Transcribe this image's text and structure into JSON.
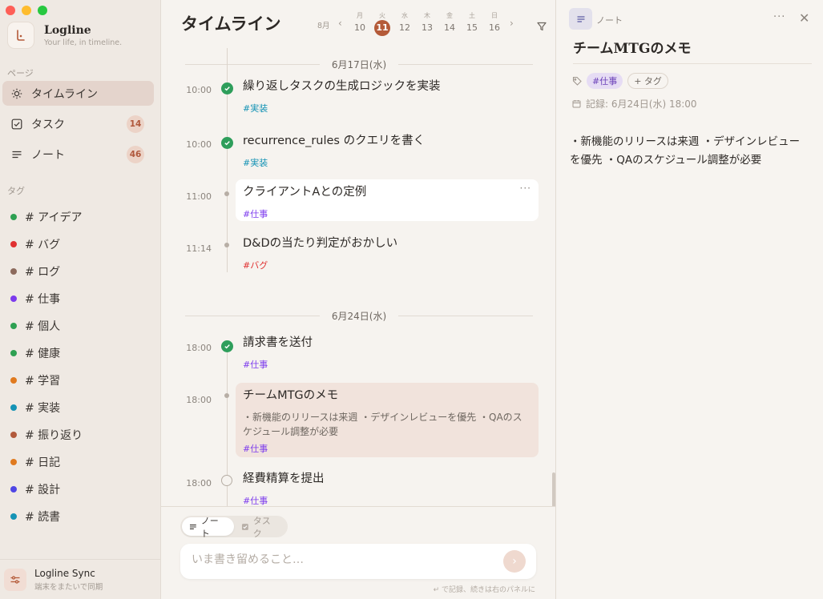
{
  "app": {
    "name": "Logline",
    "tagline": "Your life, in timeline."
  },
  "sidebar": {
    "pages_label": "ページ",
    "nav": [
      {
        "label": "タイムライン",
        "icon": "sun-icon",
        "badge": ""
      },
      {
        "label": "タスク",
        "icon": "checkbox-icon",
        "badge": "14"
      },
      {
        "label": "ノート",
        "icon": "lines-icon",
        "badge": "46"
      }
    ],
    "tags_label": "タグ",
    "tags": [
      {
        "label": "# アイデア",
        "color": "#2ea052"
      },
      {
        "label": "# バグ",
        "color": "#e03131"
      },
      {
        "label": "# ログ",
        "color": "#8c6a5c"
      },
      {
        "label": "# 仕事",
        "color": "#7c3aed"
      },
      {
        "label": "# 個人",
        "color": "#2ea052"
      },
      {
        "label": "# 健康",
        "color": "#2ea052"
      },
      {
        "label": "# 学習",
        "color": "#e07a1f"
      },
      {
        "label": "# 実装",
        "color": "#1593b5"
      },
      {
        "label": "# 振り返り",
        "color": "#b25a3c"
      },
      {
        "label": "# 日記",
        "color": "#e07a1f"
      },
      {
        "label": "# 設計",
        "color": "#4f46e5"
      },
      {
        "label": "# 読書",
        "color": "#1593b5"
      }
    ],
    "sync": {
      "title": "Logline Sync",
      "subtitle": "端末をまたいで同期"
    }
  },
  "timeline": {
    "title": "タイムライン",
    "month": "8月",
    "days": [
      {
        "weekday": "月",
        "num": "10",
        "active": false
      },
      {
        "weekday": "火",
        "num": "11",
        "active": true
      },
      {
        "weekday": "水",
        "num": "12",
        "active": false
      },
      {
        "weekday": "木",
        "num": "13",
        "active": false
      },
      {
        "weekday": "金",
        "num": "14",
        "active": false
      },
      {
        "weekday": "土",
        "num": "15",
        "active": false
      },
      {
        "weekday": "日",
        "num": "16",
        "active": false
      }
    ],
    "groups": [
      {
        "date": "6月17日(水)",
        "entries": [
          {
            "time": "10:00",
            "title": "繰り返しタスクの生成ロジックを実装",
            "tag": "#実装",
            "tag_color": "#1593b5",
            "status": "done"
          },
          {
            "time": "10:00",
            "title": "recurrence_rules のクエリを書く",
            "tag": "#実装",
            "tag_color": "#1593b5",
            "status": "done"
          },
          {
            "time": "11:00",
            "title": "クライアントAとの定例",
            "tag": "#仕事",
            "tag_color": "#7c3aed",
            "status": "note"
          },
          {
            "time": "11:14",
            "title": "D&Dの当たり判定がおかしい",
            "tag": "#バグ",
            "tag_color": "#e03131",
            "status": "note"
          }
        ]
      },
      {
        "date": "6月24日(水)",
        "entries": [
          {
            "time": "18:00",
            "title": "請求書を送付",
            "tag": "#仕事",
            "tag_color": "#7c3aed",
            "status": "done"
          },
          {
            "time": "18:00",
            "title": "チームMTGのメモ",
            "body": "・新機能のリリースは来週 ・デザインレビューを優先 ・QAのスケジュール調整が必要",
            "tag": "#仕事",
            "tag_color": "#7c3aed",
            "status": "note"
          },
          {
            "time": "18:00",
            "title": "経費精算を提出",
            "tag": "#仕事",
            "tag_color": "#7c3aed",
            "status": "open"
          }
        ]
      }
    ],
    "composer": {
      "mode_note": "ノート",
      "mode_task": "タスク",
      "placeholder": "いま書き留めること…",
      "hint": "↵ で記録、続きは右のパネルに"
    }
  },
  "detail": {
    "type_label": "ノート",
    "title": "チームMTGのメモ",
    "tag": "#仕事",
    "add_tag": "+ タグ",
    "recorded": "記録: 6月24日(水) 18:00",
    "body": "・新機能のリリースは来週 ・デザインレビューを優先 ・QAのスケジュール調整が必要"
  }
}
